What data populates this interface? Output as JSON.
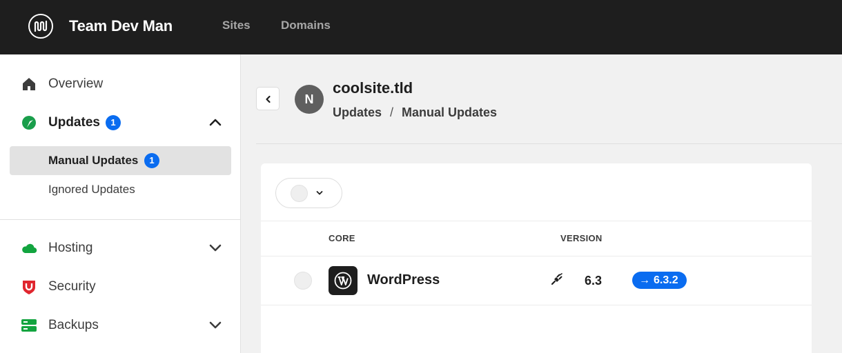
{
  "topbar": {
    "logo_icon": "team-logo-icon",
    "team_name": "Team Dev Man",
    "nav": [
      "Sites",
      "Domains"
    ]
  },
  "sidebar": {
    "items": [
      {
        "label": "Overview",
        "icon": "home-icon"
      },
      {
        "label": "Updates",
        "icon": "updates-icon",
        "badge": "1",
        "expanded": true,
        "children": [
          {
            "label": "Manual Updates",
            "badge": "1",
            "selected": true
          },
          {
            "label": "Ignored Updates"
          }
        ]
      },
      {
        "label": "Hosting",
        "icon": "cloud-icon"
      },
      {
        "label": "Security",
        "icon": "shield-icon"
      },
      {
        "label": "Backups",
        "icon": "backups-icon"
      }
    ]
  },
  "header": {
    "avatar_letter": "N",
    "site_name": "coolsite.tld",
    "breadcrumb": [
      "Updates",
      "Manual Updates"
    ],
    "breadcrumb_separator": "/"
  },
  "table": {
    "columns": {
      "name": "CORE",
      "version": "VERSION"
    },
    "rows": [
      {
        "name": "WordPress",
        "icon": "wordpress-icon",
        "status_icon": "plug-icon",
        "current_version": "6.3",
        "new_version": "6.3.2"
      }
    ]
  },
  "colors": {
    "topbar_bg": "#1e1e1e",
    "accent_blue": "#0a6cf0",
    "updates_green": "#1a9e4b",
    "hosting_green": "#12a43f",
    "security_red": "#e0262e",
    "backups_green": "#12a43f"
  }
}
